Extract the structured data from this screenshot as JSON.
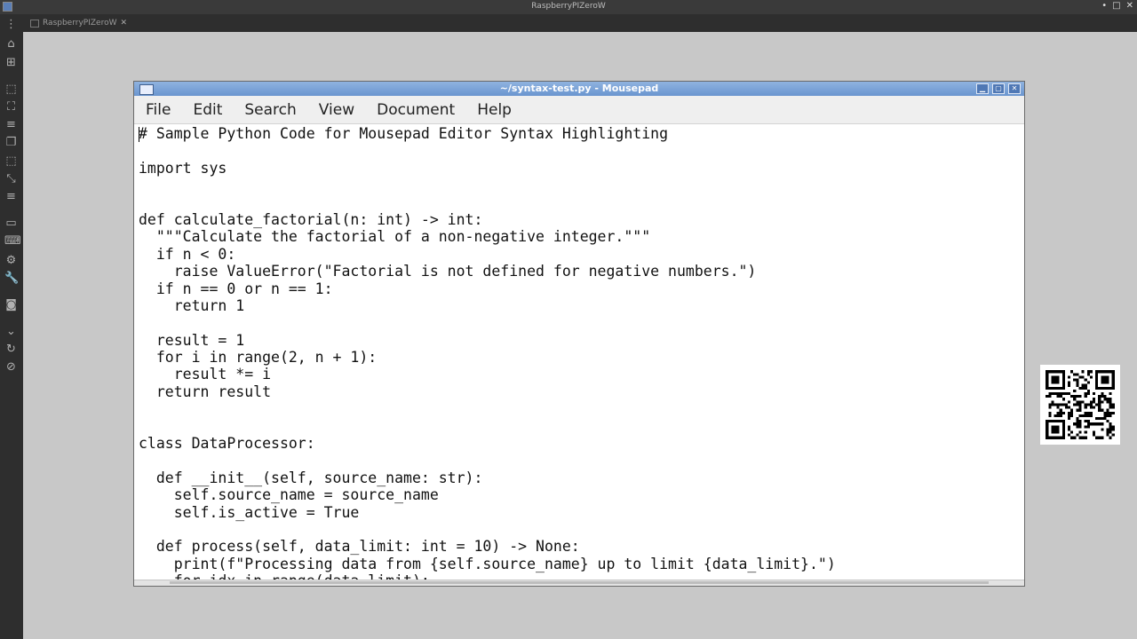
{
  "host": {
    "window_title": "RaspberryPIZeroW",
    "tab_label": "RaspberryPIZeroW",
    "sidebar_icons": [
      "menu-dots-icon",
      "home-icon",
      "add-tab-icon",
      "fit-screen-icon",
      "fullscreen-icon",
      "list-icon",
      "copy-icon",
      "scale-icon",
      "resize-icon",
      "lines-icon",
      "monitor-icon",
      "keyboard-icon",
      "gear-icon",
      "wrench-icon",
      "camera-icon",
      "chevron-down-icon",
      "refresh-icon",
      "disconnect-icon"
    ]
  },
  "editor": {
    "window_title": "~/syntax-test.py - Mousepad",
    "menu": [
      "File",
      "Edit",
      "Search",
      "View",
      "Document",
      "Help"
    ],
    "code_lines": [
      "# Sample Python Code for Mousepad Editor Syntax Highlighting",
      "",
      "import sys",
      "",
      "",
      "def calculate_factorial(n: int) -> int:",
      "  \"\"\"Calculate the factorial of a non-negative integer.\"\"\"",
      "  if n < 0:",
      "    raise ValueError(\"Factorial is not defined for negative numbers.\")",
      "  if n == 0 or n == 1:",
      "    return 1",
      "",
      "  result = 1",
      "  for i in range(2, n + 1):",
      "    result *= i",
      "  return result",
      "",
      "",
      "class DataProcessor:",
      "",
      "  def __init__(self, source_name: str):",
      "    self.source_name = source_name",
      "    self.is_active = True",
      "",
      "  def process(self, data_limit: int = 10) -> None:",
      "    print(f\"Processing data from {self.source_name} up to limit {data_limit}.\")",
      "    for idx in range(data_limit):"
    ]
  }
}
